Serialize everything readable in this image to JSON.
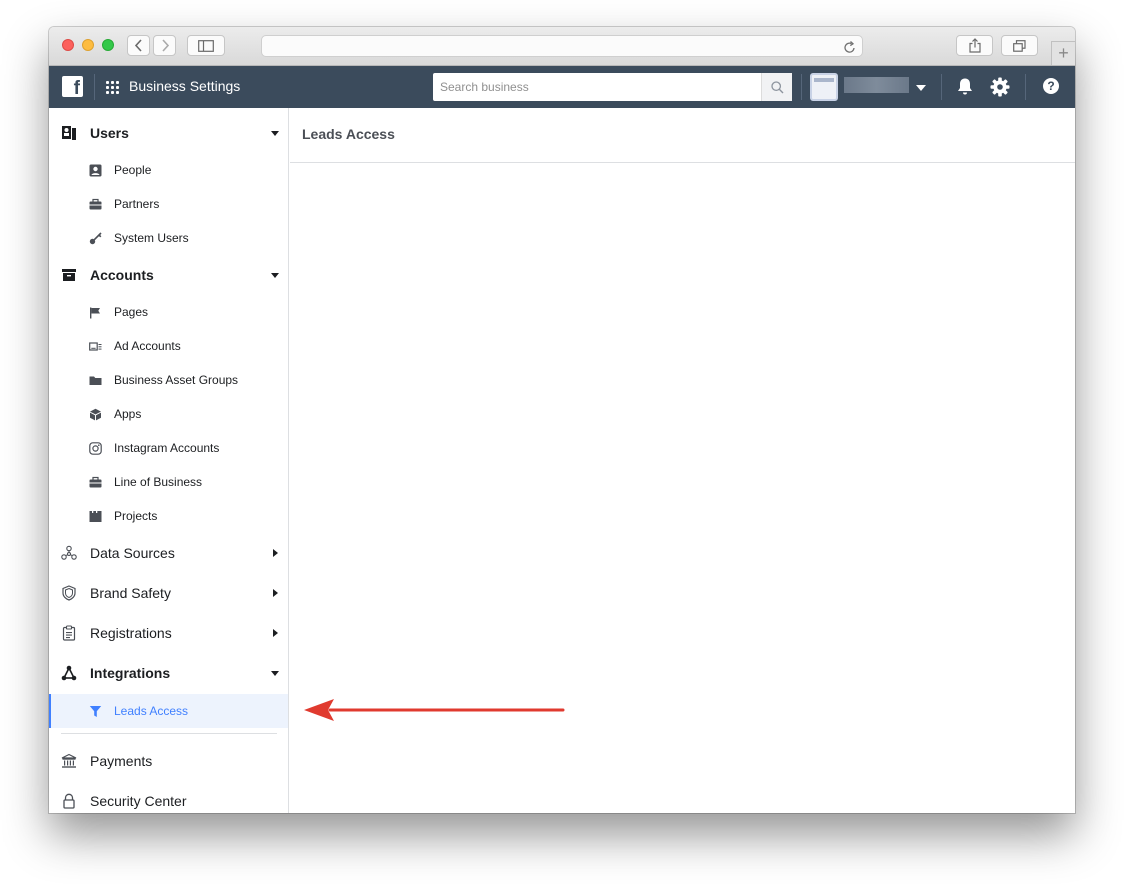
{
  "topbar": {
    "title": "Business Settings",
    "search_placeholder": "Search business",
    "search_value": ""
  },
  "sidebar": {
    "sections": [
      {
        "label": "Users",
        "icon": "users-icon",
        "expanded": true,
        "items": [
          {
            "label": "People",
            "icon": "person-icon"
          },
          {
            "label": "Partners",
            "icon": "briefcase-icon"
          },
          {
            "label": "System Users",
            "icon": "key-icon"
          }
        ]
      },
      {
        "label": "Accounts",
        "icon": "archive-icon",
        "expanded": true,
        "items": [
          {
            "label": "Pages",
            "icon": "flag-icon"
          },
          {
            "label": "Ad Accounts",
            "icon": "ad-account-icon"
          },
          {
            "label": "Business Asset Groups",
            "icon": "folder-icon"
          },
          {
            "label": "Apps",
            "icon": "cube-icon"
          },
          {
            "label": "Instagram Accounts",
            "icon": "instagram-icon"
          },
          {
            "label": "Line of Business",
            "icon": "briefcase-icon"
          },
          {
            "label": "Projects",
            "icon": "clapper-icon"
          }
        ]
      },
      {
        "label": "Data Sources",
        "icon": "data-sources-icon",
        "expanded": false,
        "items": []
      },
      {
        "label": "Brand Safety",
        "icon": "shield-icon",
        "expanded": false,
        "items": []
      },
      {
        "label": "Registrations",
        "icon": "clipboard-icon",
        "expanded": false,
        "items": []
      },
      {
        "label": "Integrations",
        "icon": "integrations-icon",
        "expanded": true,
        "items": [
          {
            "label": "Leads Access",
            "icon": "funnel-icon",
            "active": true
          }
        ]
      },
      {
        "label": "Payments",
        "icon": "bank-icon",
        "expanded": false,
        "items": []
      },
      {
        "label": "Security Center",
        "icon": "lock-icon",
        "expanded": false,
        "items": []
      }
    ]
  },
  "main": {
    "title": "Leads Access"
  },
  "colors": {
    "topbar_bg": "#3b4b5c",
    "active_accent": "#4080ff",
    "active_bg": "#edf3fd",
    "annotation_arrow": "#e03a2f"
  }
}
